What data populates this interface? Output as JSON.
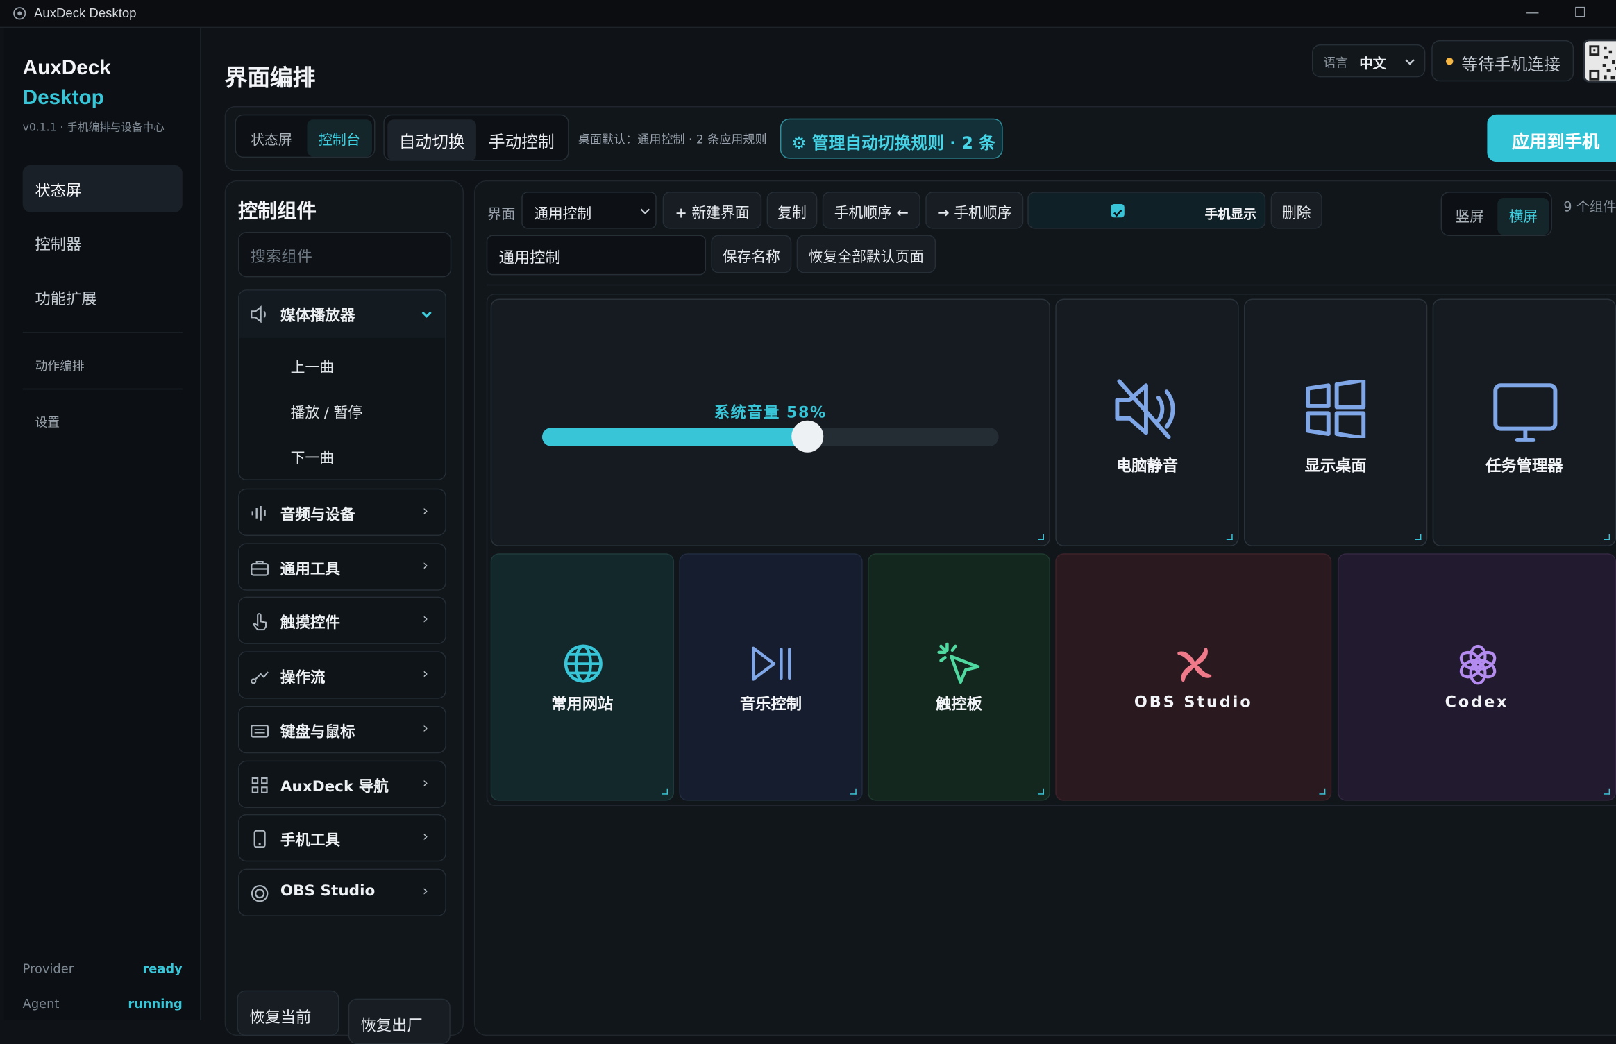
{
  "window": {
    "title": "AuxDeck Desktop"
  },
  "brand": {
    "name1": "AuxDeck",
    "name2": "Desktop",
    "version": "v0.1.1 · 手机编排与设备中心"
  },
  "sidebar": {
    "items": [
      {
        "label": "状态屏"
      },
      {
        "label": "控制器"
      },
      {
        "label": "功能扩展"
      },
      {
        "label": "动作编排"
      },
      {
        "label": "设置"
      }
    ],
    "status": [
      {
        "key": "Provider",
        "value": "ready"
      },
      {
        "key": "Agent",
        "value": "running"
      }
    ]
  },
  "header": {
    "title": "界面编排",
    "lang_label": "语言",
    "lang_value": "中文",
    "connection": "等待手机连接",
    "connection_color": "#f5b642"
  },
  "toolbar": {
    "tabs": [
      "状态屏",
      "控制台"
    ],
    "modes": [
      "自动切换",
      "手动控制"
    ],
    "hint": "桌面默认：通用控制 · 2 条应用规则",
    "rules_button": "管理自动切换规则 · 2 条",
    "apply_button": "应用到手机"
  },
  "components": {
    "title": "控制组件",
    "search_placeholder": "搜索组件",
    "media": {
      "name": "媒体播放器",
      "items": [
        "上一曲",
        "播放 / 暂停",
        "下一曲"
      ]
    },
    "categories": [
      "音频与设备",
      "通用工具",
      "触摸控件",
      "操作流",
      "键盘与鼠标",
      "AuxDeck 导航",
      "手机工具",
      "OBS Studio"
    ],
    "bottom_buttons": [
      "恢复当前",
      "恢复出厂"
    ]
  },
  "editor": {
    "interface_label": "界面",
    "interface_value": "通用控制",
    "new_button": "+ 新建界面",
    "copy_button": "复制",
    "order_prev": "手机顺序 ←",
    "order_next": "→ 手机顺序",
    "phone_display": "手机显示",
    "phone_display_checked": true,
    "delete_button": "删除",
    "name_value": "通用控制",
    "save_name": "保存名称",
    "restore_all": "恢复全部默认页面",
    "orientation": [
      "竖屏",
      "横屏"
    ],
    "orientation_selected": "横屏",
    "count": "9 个组件"
  },
  "tiles": {
    "volume": {
      "label": "系统音量 58%",
      "percent": 58
    },
    "mute": "电脑静音",
    "desktop": "显示桌面",
    "taskmgr": "任务管理器",
    "web": "常用网站",
    "music": "音乐控制",
    "touchpad": "触控板",
    "obs": "OBS Studio",
    "codex": "Codex"
  },
  "colors": {
    "accent": "#38c5d8",
    "apply": "#33c3d6"
  }
}
